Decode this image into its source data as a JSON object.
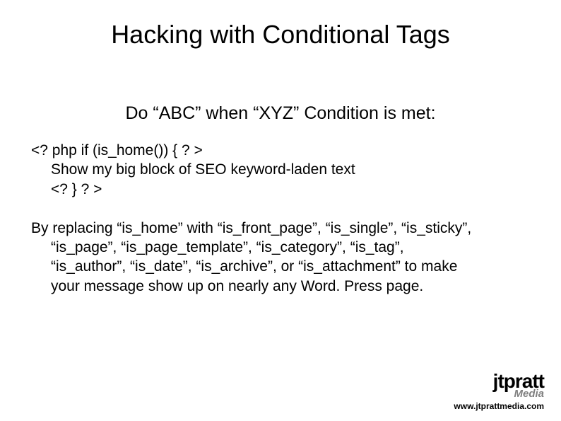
{
  "title": "Hacking with Conditional Tags",
  "subtitle": "Do “ABC” when “XYZ” Condition is met:",
  "code": {
    "line1": "<? php if (is_home()) { ? >",
    "line2": "Show my big block of SEO keyword-laden text",
    "line3": "<? } ? >"
  },
  "explain": {
    "line1": "By replacing “is_home” with “is_front_page”, “is_single”, “is_sticky”,",
    "line2": "“is_page”, “is_page_template”, “is_category”, “is_tag”,",
    "line3": "“is_author”, “is_date”, “is_archive”, or “is_attachment” to make",
    "line4": "your message show up on nearly any Word. Press page."
  },
  "logo": {
    "main": "jtpratt",
    "sub": "Media",
    "url": "www.jtprattmedia.com"
  }
}
